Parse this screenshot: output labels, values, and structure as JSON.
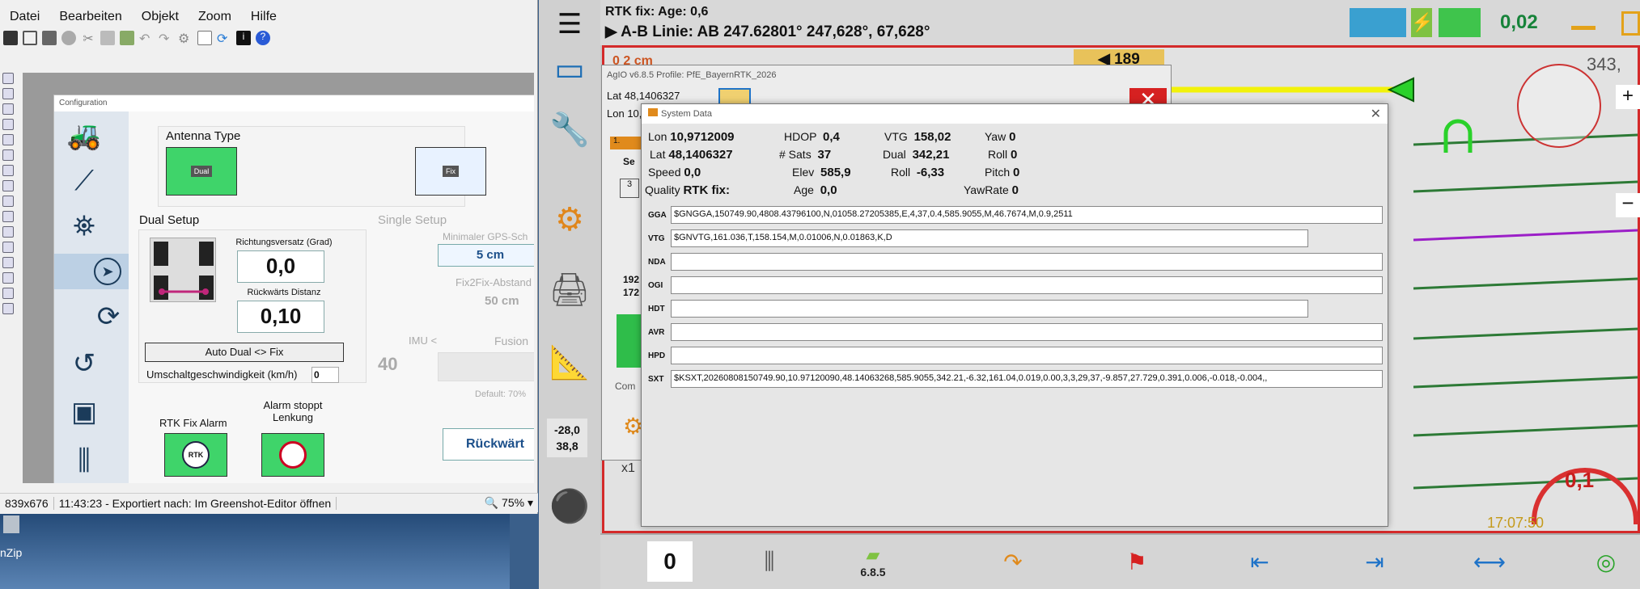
{
  "greenshot": {
    "menu": [
      "Datei",
      "Bearbeiten",
      "Objekt",
      "Zoom",
      "Hilfe"
    ],
    "status": {
      "size": "839x676",
      "message": "11:43:23 - Exportiert nach: Im Greenshot-Editor öffnen",
      "zoom": "75%"
    }
  },
  "config": {
    "title": "Configuration",
    "antenna_type": "Antenna Type",
    "dual_label": "Dual",
    "fix_label": "Fix",
    "dual_setup": "Dual Setup",
    "single_setup": "Single Setup",
    "heading_offset_label": "Richtungsversatz (Grad)",
    "heading_offset_value": "0,0",
    "reverse_distance_label": "Rückwärts Distanz",
    "reverse_distance_value": "0,10",
    "auto_dual_fix": "Auto Dual <> Fix",
    "switch_speed_label": "Umschaltgeschwindigkeit (km/h)",
    "switch_speed_value": "0",
    "min_gps_label": "Minimaler GPS-Sch",
    "min_gps_value": "5 cm",
    "fix2fix_label": "Fix2Fix-Abstand",
    "fix2fix_value": "50 cm",
    "imu_label": "IMU <",
    "fusion_label": "Fusion",
    "imu_value": "40",
    "default_label": "Default: 70%",
    "rtk_alarm_label": "RTK Fix Alarm",
    "alarm_stops_label": "Alarm stoppt Lenkung",
    "reverse_button": "Rückwärt"
  },
  "desktop": {
    "icon_label": "nZip"
  },
  "aog": {
    "rtk_status": "RTK fix: Age: 0,6",
    "ab_line": "▶ A-B Linie: AB 247.62801°  247,628°, 67,628°",
    "top_value": "0,02",
    "heading_value": "343,",
    "field_offset": "0  2 cm",
    "field_distance": "◀ 189",
    "left_readout_top": "-28,0",
    "left_readout_bottom": "38,8",
    "speed_readout": "0,1",
    "clock": "17:07:50",
    "bottom": {
      "dropdown_value": "0",
      "version": "6.8.5"
    }
  },
  "agio": {
    "title": "AgIO  v6.8.5 Profile: PfE_BayernRTK_2026",
    "lat_label": "Lat",
    "lat_value": "48,1406327",
    "lon_label": "Lon",
    "lon_value": "10,",
    "partial_192": "192",
    "partial_172": "172",
    "partial_com": "Com",
    "partial_x1": "x1",
    "partial_1": "1.",
    "partial_se": "Se",
    "partial_3": "3"
  },
  "system_data": {
    "title": "System Data",
    "col1": [
      {
        "label": "Lon",
        "value": "10,9712009"
      },
      {
        "label": "Lat",
        "value": "48,1406327"
      },
      {
        "label": "Speed",
        "value": "0,0"
      },
      {
        "label": "Quality",
        "value": "RTK fix:"
      }
    ],
    "col2": [
      {
        "label": "HDOP",
        "value": "0,4"
      },
      {
        "label": "# Sats",
        "value": "37"
      },
      {
        "label": "Elev",
        "value": "585,9"
      },
      {
        "label": "Age",
        "value": "0,0"
      }
    ],
    "col3": [
      {
        "label": "VTG",
        "value": "158,02"
      },
      {
        "label": "Dual",
        "value": "342,21"
      },
      {
        "label": "Roll",
        "value": "-6,33"
      }
    ],
    "col4": [
      {
        "label": "Yaw",
        "value": "0"
      },
      {
        "label": "Roll",
        "value": "0"
      },
      {
        "label": "Pitch",
        "value": "0"
      },
      {
        "label": "YawRate",
        "value": "0"
      }
    ],
    "sentences": [
      {
        "label": "GGA",
        "value": "$GNGGA,150749.90,4808.43796100,N,01058.27205385,E,4,37,0.4,585.9055,M,46.7674,M,0.9,2511"
      },
      {
        "label": "VTG",
        "value": "$GNVTG,161.036,T,158.154,M,0.01006,N,0.01863,K,D"
      },
      {
        "label": "NDA",
        "value": ""
      },
      {
        "label": "OGI",
        "value": ""
      },
      {
        "label": "HDT",
        "value": ""
      },
      {
        "label": "AVR",
        "value": ""
      },
      {
        "label": "HPD",
        "value": ""
      },
      {
        "label": "SXT",
        "value": "$KSXT,20260808150749.90,10.97120090,48.14063268,585.9055,342.21,-6.32,161.04,0.019,0.00,3,3,29,37,-9.857,27.729,0.391,0.006,-0.018,-0.004,,"
      }
    ]
  },
  "colors": {
    "accent_green": "#2fbd4a",
    "field_border": "#d42a2a",
    "readout_red": "#c81d1d"
  }
}
